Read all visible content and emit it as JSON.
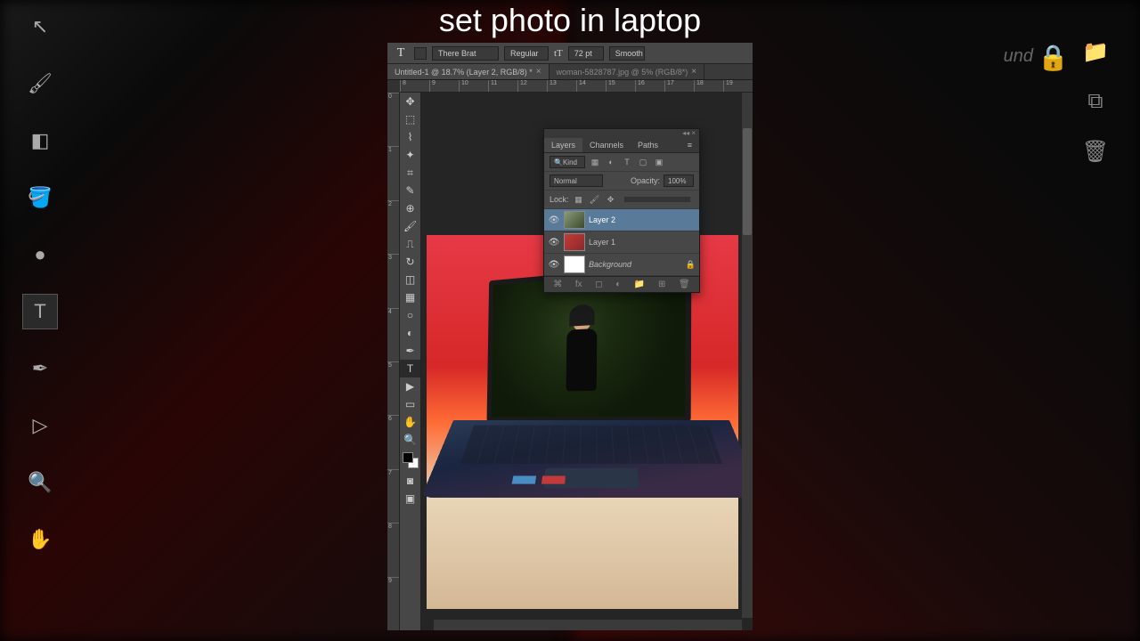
{
  "title_overlay": "set photo in laptop",
  "bg_label": "und",
  "options_bar": {
    "font_family": "There Brat",
    "font_style": "Regular",
    "font_size": "72 pt",
    "anti_alias": "Smooth"
  },
  "tabs": [
    {
      "label": "Untitled-1 @ 18.7% (Layer 2, RGB/8) *",
      "active": true
    },
    {
      "label": "woman-5828787.jpg @ 5% (RGB/8*)",
      "active": false
    }
  ],
  "ruler_h": [
    "8",
    "9",
    "10",
    "11",
    "12",
    "13",
    "14",
    "15",
    "16",
    "17",
    "18",
    "19"
  ],
  "ruler_v": [
    "0",
    "1",
    "2",
    "3",
    "4",
    "5",
    "6",
    "7",
    "8",
    "9"
  ],
  "layers_panel": {
    "tabs": [
      "Layers",
      "Channels",
      "Paths"
    ],
    "kind_label": "Kind",
    "blend_mode": "Normal",
    "opacity_label": "Opacity:",
    "opacity_value": "100%",
    "lock_label": "Lock:",
    "layers": [
      {
        "name": "Layer 2",
        "selected": true,
        "locked": false
      },
      {
        "name": "Layer 1",
        "selected": false,
        "locked": false
      },
      {
        "name": "Background",
        "selected": false,
        "locked": true,
        "italic": true
      }
    ]
  }
}
